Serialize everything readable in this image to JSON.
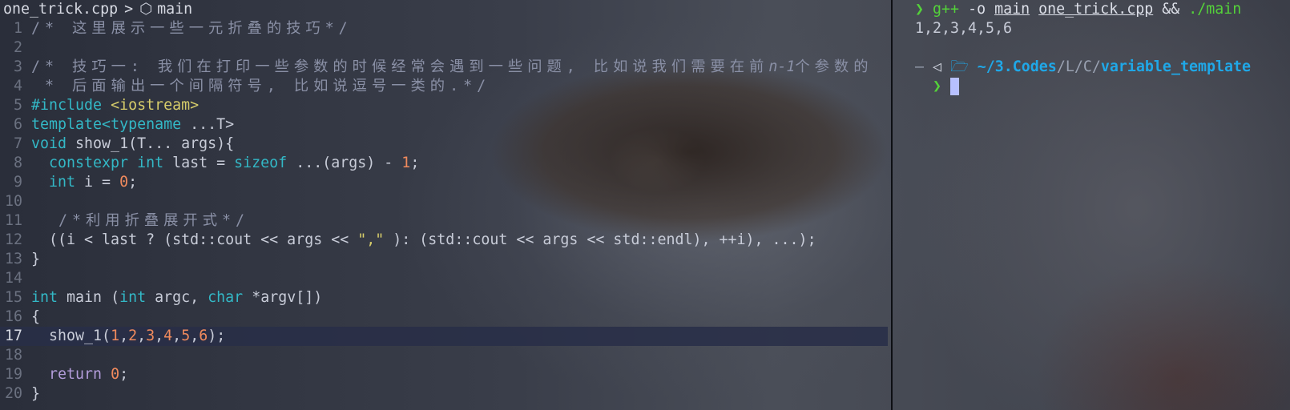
{
  "editor": {
    "filename": "one_trick.cpp",
    "breadcrumb_sep": ">",
    "symbol": "main",
    "symbol_icon": "cube-icon",
    "current_line": 17,
    "lines": [
      {
        "n": "1",
        "t": "/* 这里展示一些一元折叠的技巧*/"
      },
      {
        "n": "2",
        "t": ""
      },
      {
        "n": "3a",
        "t": "/* 技巧一: 我们在打印一些参数的时候经常会遇到一些问题, 比如说我们需要在前"
      },
      {
        "n": "3b",
        "t": "n-1"
      },
      {
        "n": "3c",
        "t": "个参数的"
      },
      {
        "n": "4",
        "t": " * 后面输出一个间隔符号, 比如说逗号一类的.*/"
      },
      {
        "n": "5a",
        "t": "#include"
      },
      {
        "n": "5b",
        "t": "<iostream>"
      },
      {
        "n": "6a",
        "t": "template<"
      },
      {
        "n": "6b",
        "t": "typename"
      },
      {
        "n": "6c",
        "t": " ...T>"
      },
      {
        "n": "7a",
        "t": "void"
      },
      {
        "n": "7b",
        "t": " show_1(T... args){"
      },
      {
        "n": "8a",
        "t": "  constexpr int"
      },
      {
        "n": "8b",
        "t": " last = "
      },
      {
        "n": "8c",
        "t": "sizeof"
      },
      {
        "n": "8d",
        "t": " ...(args) - "
      },
      {
        "n": "8e",
        "t": "1"
      },
      {
        "n": "8f",
        "t": ";"
      },
      {
        "n": "9a",
        "t": "  int"
      },
      {
        "n": "9b",
        "t": " i = "
      },
      {
        "n": "9c",
        "t": "0"
      },
      {
        "n": "9d",
        "t": ";"
      },
      {
        "n": "10",
        "t": ""
      },
      {
        "n": "11",
        "t": "  /*利用折叠展开式*/"
      },
      {
        "n": "12a",
        "t": "  ((i < last ? (std::cout << args << "
      },
      {
        "n": "12b",
        "t": "\",\""
      },
      {
        "n": "12c",
        "t": " ): (std::cout << args << std::endl), ++i), ...);"
      },
      {
        "n": "13",
        "t": "}"
      },
      {
        "n": "14",
        "t": ""
      },
      {
        "n": "15a",
        "t": "int"
      },
      {
        "n": "15b",
        "t": " main ("
      },
      {
        "n": "15c",
        "t": "int"
      },
      {
        "n": "15d",
        "t": " argc, "
      },
      {
        "n": "15e",
        "t": "char"
      },
      {
        "n": "15f",
        "t": " *argv[])"
      },
      {
        "n": "16",
        "t": "{"
      },
      {
        "n": "17a",
        "t": "  show_1("
      },
      {
        "n": "17b",
        "t": "1"
      },
      {
        "n": "17c",
        "t": ","
      },
      {
        "n": "17d",
        "t": "2"
      },
      {
        "n": "17e",
        "t": ","
      },
      {
        "n": "17f",
        "t": "3"
      },
      {
        "n": "17g",
        "t": ","
      },
      {
        "n": "17h",
        "t": "4"
      },
      {
        "n": "17i",
        "t": ","
      },
      {
        "n": "17j",
        "t": "5"
      },
      {
        "n": "17k",
        "t": ","
      },
      {
        "n": "17l",
        "t": "6"
      },
      {
        "n": "17m",
        "t": ");"
      },
      {
        "n": "18",
        "t": ""
      },
      {
        "n": "19a",
        "t": "  return"
      },
      {
        "n": "19b",
        "t": " "
      },
      {
        "n": "19c",
        "t": "0"
      },
      {
        "n": "19d",
        "t": ";"
      },
      {
        "n": "20",
        "t": "}"
      }
    ],
    "line_numbers": [
      "1",
      "2",
      "3",
      "4",
      "5",
      "6",
      "7",
      "8",
      "9",
      "10",
      "11",
      "12",
      "13",
      "14",
      "15",
      "16",
      "17",
      "18",
      "19",
      "20"
    ]
  },
  "terminal": {
    "prompt_char": "❯",
    "cmd_program": "g++",
    "cmd_flag": " -o ",
    "cmd_out": "main",
    "cmd_src": "one_trick.cpp",
    "cmd_and": " && ",
    "cmd_run": "./main",
    "output": "1,2,3,4,5,6",
    "path_home": "~/",
    "path_seg1": "3.Codes",
    "path_slash": "/",
    "path_seg2": "L",
    "path_seg3": "C",
    "path_last": "variable_template",
    "dash": "—",
    "icon_triangle": "◁",
    "icon_folder": "folder-icon"
  }
}
